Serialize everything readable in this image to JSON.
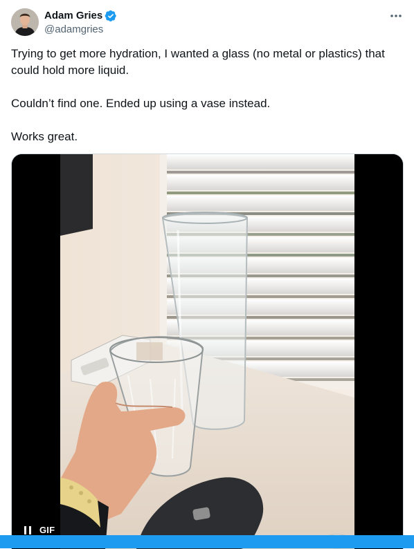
{
  "author": {
    "display_name": "Adam Gries",
    "handle": "@adamgries",
    "verified": true,
    "avatar_icon": "person-avatar"
  },
  "menu_icon": "more-horizontal-icon",
  "tweet": {
    "paragraphs": [
      "Trying to get more hydration, I wanted a glass (no metal or plastics) that could hold more liquid.",
      "Couldn’t find one. Ended up using a vase instead.",
      "Works great."
    ]
  },
  "media": {
    "type": "gif",
    "badge": "GIF",
    "control_icon": "pause-icon",
    "depicts": "hand-holding-glass-next-to-tall-glass-vase"
  },
  "colors": {
    "accent": "#1d9bf0",
    "verified_badge": "#1d9bf0",
    "text_primary": "#0f1419",
    "text_secondary": "#536471",
    "border": "#cfd9de"
  }
}
